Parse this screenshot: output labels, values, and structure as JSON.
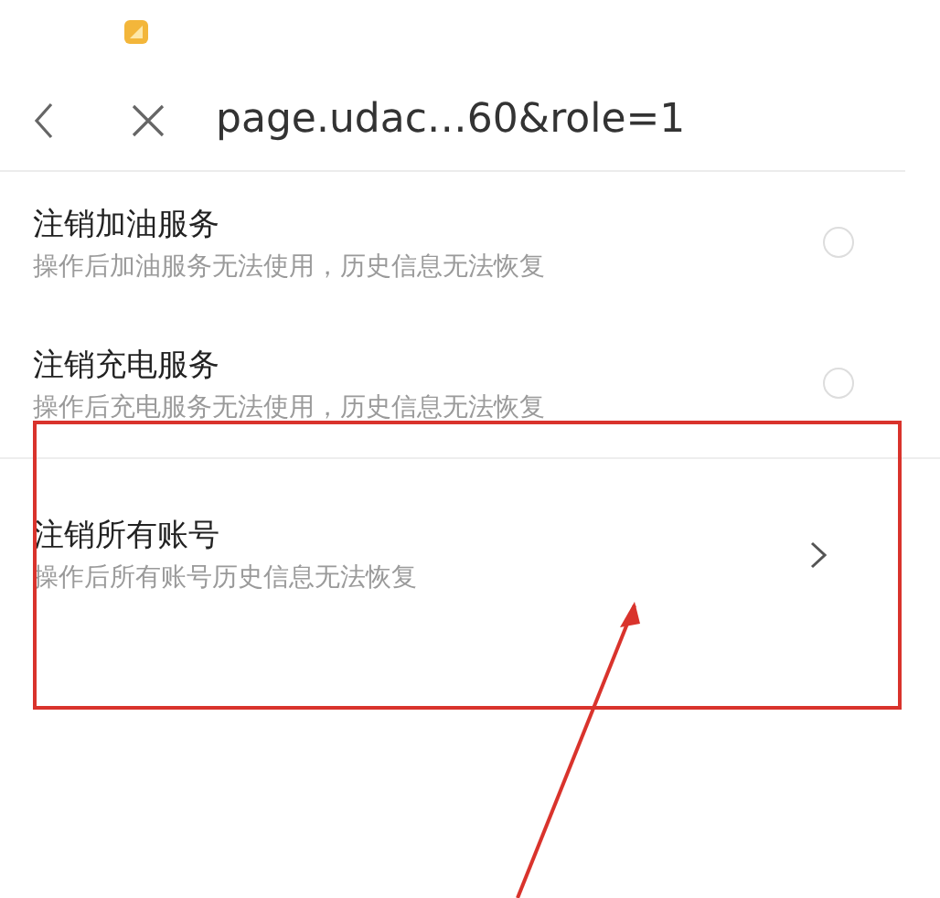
{
  "nav_bar": {
    "title": "page.udac…60&role=1"
  },
  "options": [
    {
      "kind": "radio",
      "title": "注销加油服务",
      "description": "操作后加油服务无法使用，历史信息无法恢复",
      "selected": false
    },
    {
      "kind": "radio",
      "title": "注销充电服务",
      "description": "操作后充电服务无法使用，历史信息无法恢复",
      "selected": false
    },
    {
      "kind": "link",
      "title": "注销所有账号",
      "description": "操作后所有账号历史信息无法恢复"
    }
  ]
}
